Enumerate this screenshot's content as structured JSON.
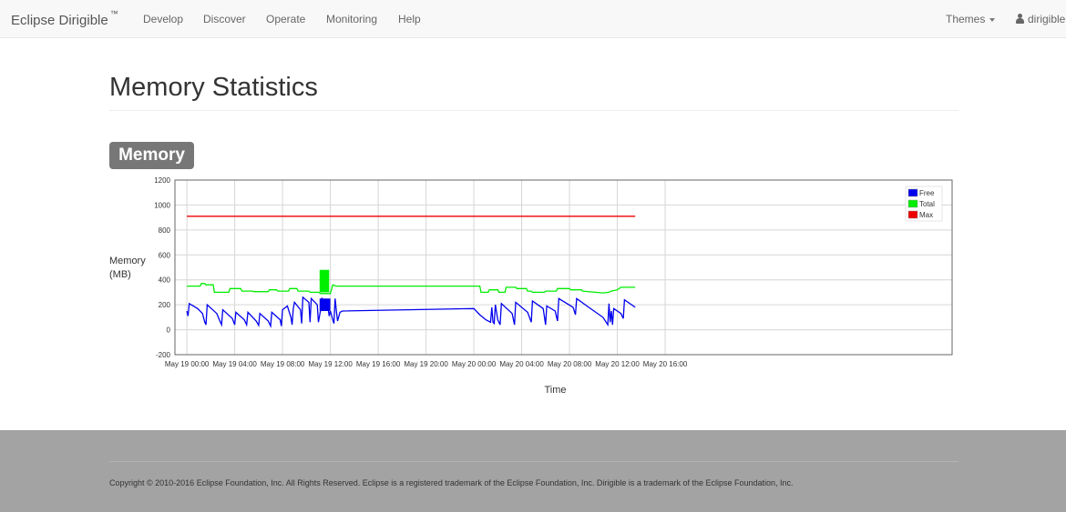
{
  "navbar": {
    "brand": "Eclipse Dirigible",
    "brand_mark": "™",
    "items": [
      "Develop",
      "Discover",
      "Operate",
      "Monitoring",
      "Help"
    ],
    "themes_label": "Themes",
    "user_label": "dirigible"
  },
  "page": {
    "title": "Memory Statistics",
    "section_label": "Memory"
  },
  "chart_data": {
    "type": "line",
    "ylabel": "Memory\n(MB)",
    "xlabel": "Time",
    "ylim": [
      -200,
      1200
    ],
    "yticks": [
      -200,
      0,
      200,
      400,
      600,
      800,
      1000,
      1200
    ],
    "xlim_hours": [
      -1,
      64
    ],
    "xticks": [
      {
        "t": 0,
        "label": "May 19 00:00"
      },
      {
        "t": 4,
        "label": "May 19 04:00"
      },
      {
        "t": 8,
        "label": "May 19 08:00"
      },
      {
        "t": 12,
        "label": "May 19 12:00"
      },
      {
        "t": 16,
        "label": "May 19 16:00"
      },
      {
        "t": 20,
        "label": "May 19 20:00"
      },
      {
        "t": 24,
        "label": "May 20 00:00"
      },
      {
        "t": 28,
        "label": "May 20 04:00"
      },
      {
        "t": 32,
        "label": "May 20 08:00"
      },
      {
        "t": 36,
        "label": "May 20 12:00"
      },
      {
        "t": 40,
        "label": "May 20 16:00"
      }
    ],
    "grid": true,
    "legend_position": "top-right",
    "series": [
      {
        "name": "Free",
        "color": "#0000ee",
        "points": [
          [
            0,
            150
          ],
          [
            0.1,
            110
          ],
          [
            0.2,
            210
          ],
          [
            0.9,
            170
          ],
          [
            1.3,
            130
          ],
          [
            1.5,
            60
          ],
          [
            1.6,
            40
          ],
          [
            1.7,
            200
          ],
          [
            2.5,
            130
          ],
          [
            2.8,
            60
          ],
          [
            2.9,
            40
          ],
          [
            3.0,
            160
          ],
          [
            3.8,
            90
          ],
          [
            4.0,
            40
          ],
          [
            4.1,
            140
          ],
          [
            4.8,
            80
          ],
          [
            5.0,
            40
          ],
          [
            5.1,
            140
          ],
          [
            5.8,
            70
          ],
          [
            6.0,
            35
          ],
          [
            6.1,
            130
          ],
          [
            6.8,
            70
          ],
          [
            7.0,
            30
          ],
          [
            7.1,
            140
          ],
          [
            7.8,
            80
          ],
          [
            7.9,
            30
          ],
          [
            8.0,
            160
          ],
          [
            8.4,
            190
          ],
          [
            8.7,
            100
          ],
          [
            8.8,
            40
          ],
          [
            8.9,
            170
          ],
          [
            9.0,
            220
          ],
          [
            9.5,
            160
          ],
          [
            9.6,
            50
          ],
          [
            9.7,
            260
          ],
          [
            10.2,
            220
          ],
          [
            10.3,
            60
          ],
          [
            10.4,
            250
          ],
          [
            10.9,
            200
          ],
          [
            11.0,
            60
          ],
          [
            11.2,
            170
          ],
          [
            11.3,
            250
          ],
          [
            11.8,
            180
          ],
          [
            11.9,
            110
          ],
          [
            12.0,
            150
          ],
          [
            12.2,
            80
          ],
          [
            12.3,
            50
          ],
          [
            12.4,
            250
          ],
          [
            12.5,
            150
          ],
          [
            12.6,
            70
          ],
          [
            12.8,
            140
          ],
          [
            13.0,
            150
          ],
          [
            24.0,
            170
          ],
          [
            24.5,
            120
          ],
          [
            25.0,
            80
          ],
          [
            25.4,
            60
          ],
          [
            25.5,
            180
          ],
          [
            25.6,
            60
          ],
          [
            25.7,
            50
          ],
          [
            25.8,
            200
          ],
          [
            26.0,
            80
          ],
          [
            26.2,
            40
          ],
          [
            26.3,
            210
          ],
          [
            27.2,
            130
          ],
          [
            27.4,
            40
          ],
          [
            27.5,
            220
          ],
          [
            28.5,
            140
          ],
          [
            28.8,
            60
          ],
          [
            28.9,
            230
          ],
          [
            29.8,
            170
          ],
          [
            30.0,
            40
          ],
          [
            30.1,
            190
          ],
          [
            30.8,
            150
          ],
          [
            31.0,
            70
          ],
          [
            31.1,
            250
          ],
          [
            32.3,
            180
          ],
          [
            32.5,
            120
          ],
          [
            32.6,
            250
          ],
          [
            33.6,
            180
          ],
          [
            34.8,
            100
          ],
          [
            35.2,
            40
          ],
          [
            35.3,
            210
          ],
          [
            35.4,
            60
          ],
          [
            35.5,
            150
          ],
          [
            35.6,
            40
          ],
          [
            35.7,
            170
          ],
          [
            36.3,
            130
          ],
          [
            36.5,
            90
          ],
          [
            36.6,
            240
          ],
          [
            37.5,
            180
          ]
        ]
      },
      {
        "name": "Total",
        "color": "#00ee00",
        "points": [
          [
            0,
            350
          ],
          [
            1.1,
            350
          ],
          [
            1.2,
            370
          ],
          [
            1.5,
            370
          ],
          [
            1.6,
            360
          ],
          [
            2.2,
            360
          ],
          [
            2.3,
            300
          ],
          [
            3.5,
            300
          ],
          [
            3.6,
            330
          ],
          [
            4.5,
            330
          ],
          [
            4.6,
            310
          ],
          [
            5.5,
            310
          ],
          [
            5.6,
            305
          ],
          [
            6.8,
            305
          ],
          [
            6.9,
            320
          ],
          [
            7.5,
            320
          ],
          [
            7.6,
            310
          ],
          [
            8.5,
            310
          ],
          [
            8.6,
            330
          ],
          [
            9.2,
            330
          ],
          [
            9.3,
            310
          ],
          [
            10.2,
            310
          ],
          [
            10.3,
            300
          ],
          [
            11.0,
            300
          ],
          [
            11.2,
            290
          ],
          [
            12.0,
            290
          ],
          [
            12.2,
            360
          ],
          [
            12.5,
            350
          ],
          [
            13.0,
            350
          ],
          [
            24.5,
            350
          ],
          [
            24.6,
            300
          ],
          [
            25.2,
            300
          ],
          [
            25.3,
            320
          ],
          [
            26.0,
            320
          ],
          [
            26.1,
            300
          ],
          [
            26.6,
            300
          ],
          [
            26.7,
            340
          ],
          [
            27.5,
            340
          ],
          [
            27.6,
            330
          ],
          [
            28.4,
            330
          ],
          [
            28.5,
            310
          ],
          [
            28.8,
            310
          ],
          [
            28.9,
            300
          ],
          [
            29.9,
            300
          ],
          [
            30.0,
            310
          ],
          [
            30.9,
            310
          ],
          [
            31.0,
            330
          ],
          [
            32.0,
            330
          ],
          [
            32.1,
            320
          ],
          [
            33.0,
            320
          ],
          [
            33.1,
            310
          ],
          [
            34.8,
            295
          ],
          [
            35.3,
            300
          ],
          [
            35.5,
            310
          ],
          [
            36.0,
            320
          ],
          [
            36.3,
            340
          ],
          [
            37.5,
            340
          ]
        ]
      },
      {
        "name": "Max",
        "color": "#ee0000",
        "points": [
          [
            0,
            910
          ],
          [
            37.5,
            910
          ]
        ]
      }
    ],
    "filled_bands": [
      {
        "series": "Total",
        "color": "#00ee00",
        "x": [
          11.1,
          11.9
        ],
        "from": 300,
        "to": 480
      },
      {
        "series": "Free",
        "color": "#0000ee",
        "x": [
          11.1,
          12.0
        ],
        "from": 150,
        "to": 250
      }
    ]
  },
  "footer": {
    "copyright": "Copyright © 2010-2016 Eclipse Foundation, Inc. All Rights Reserved. Eclipse is a registered trademark of the Eclipse Foundation, Inc. Dirigible is a trademark of the Eclipse Foundation, Inc."
  }
}
